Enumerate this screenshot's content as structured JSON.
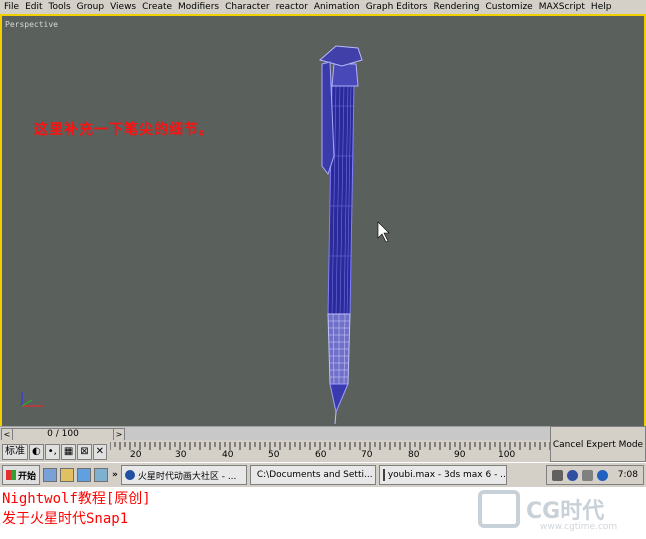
{
  "menu": [
    "File",
    "Edit",
    "Tools",
    "Group",
    "Views",
    "Create",
    "Modifiers",
    "Character",
    "reactor",
    "Animation",
    "Graph Editors",
    "Rendering",
    "Customize",
    "MAXScript",
    "Help"
  ],
  "viewport": {
    "label": "Perspective",
    "annotation": "这里补充一下笔尖的细节。"
  },
  "timeslider": {
    "frame": "0 / 100",
    "prev": "<",
    "next": ">"
  },
  "ruler": {
    "labels": [
      "20",
      "30",
      "40",
      "50",
      "60",
      "70",
      "80",
      "90",
      "100"
    ]
  },
  "tools": [
    "标准",
    "◐",
    "•,",
    "▦",
    "⊠",
    "✕"
  ],
  "cancel_expert": "Cancel Expert Mode",
  "taskbar": {
    "start": "开始",
    "more": "»",
    "tasks": [
      "火星时代动画大社区 - ...",
      "C:\\Documents and Setti...",
      "youbi.max - 3ds max 6 - ..."
    ],
    "clock": "7:08"
  },
  "credits": {
    "line1": "Nightwolf教程[原创]",
    "line2": "发于火星时代Snap1"
  },
  "logo": {
    "text": "CG时代",
    "url": "www.cgtime.com"
  },
  "colors": {
    "viewport_bg": "#5a605c",
    "wire": "#6a6ad8",
    "annotation": "#ff1010"
  }
}
